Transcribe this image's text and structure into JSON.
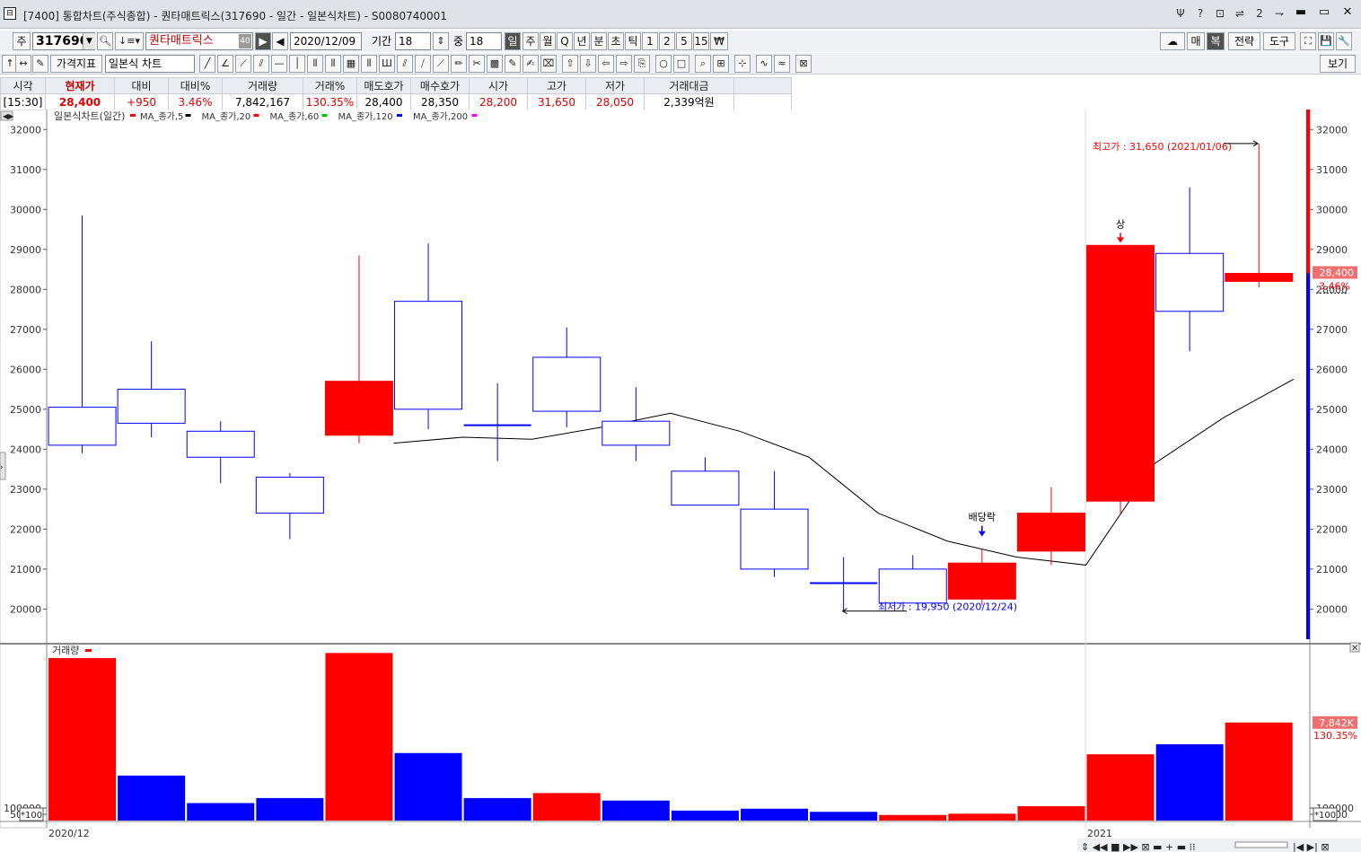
{
  "window": {
    "title": "[7400] 통합차트(주식종합) - 퀀타매트릭스(317690 - 일간 - 일본식차트) - S0080740001",
    "tbtn_icons": [
      "Ψ",
      "?",
      "⊡",
      "⇌",
      "2",
      "⇁"
    ],
    "wbtn_icons": [
      "▬",
      "▭",
      "✕"
    ]
  },
  "toolbar1": {
    "market_label": "주",
    "code": "317690",
    "stock_name": "퀀타매트릭스",
    "name_badge": "40",
    "date": "2020/12/09",
    "period_label": "기간",
    "period_value": "18",
    "mid_label": "중",
    "mid_value": "18",
    "intervals": [
      "일",
      "주",
      "월",
      "Q",
      "년",
      "분",
      "초",
      "틱",
      "1",
      "2",
      "5",
      "15",
      "₩"
    ],
    "right_buttons": [
      "매",
      "복",
      "전략",
      "도구"
    ],
    "right_icons": [
      "⛶",
      "💾",
      "🔧"
    ]
  },
  "toolbar2": {
    "indicator_btn": "가격지표",
    "chart_type": "일본식 차트",
    "view_btn": "보기"
  },
  "quote": {
    "headers": [
      "시각",
      "현재가",
      "대비",
      "대비%",
      "거래량",
      "거래%",
      "매도호가",
      "매수호가",
      "시가",
      "고가",
      "저가",
      "거래대금"
    ],
    "values": [
      "[15:30]",
      "28,400",
      "+950",
      "3.46%",
      "7,842,167",
      "130.35%",
      "28,400",
      "28,350",
      "28,200",
      "31,650",
      "28,050",
      "2,339억원"
    ]
  },
  "colors": {
    "up": "#ff0000",
    "down": "#0000ff",
    "ma20": "#000000",
    "ma5": "#ff0000",
    "ma60": "#ff0000",
    "ma120": "#00c000",
    "ma200": "#0000ff",
    "ma_extra": "#ff00ff"
  },
  "chart_data": {
    "type": "candlestick",
    "title": "일본식차트(일간)",
    "legend": [
      "MA_종가,5",
      "MA_종가,20",
      "MA_종가,60",
      "MA_종가,120",
      "MA_종가,200"
    ],
    "ylim": [
      19200,
      32500
    ],
    "yticks": [
      20000,
      21000,
      22000,
      23000,
      24000,
      25000,
      26000,
      27000,
      28000,
      29000,
      30000,
      31000,
      32000
    ],
    "candles": [
      {
        "open": 25050,
        "high": 29850,
        "low": 23900,
        "close": 24100,
        "vol": 13000
      },
      {
        "open": 25500,
        "high": 26700,
        "low": 24300,
        "close": 24650,
        "vol": 3600
      },
      {
        "open": 24450,
        "high": 24700,
        "low": 23150,
        "close": 23800,
        "vol": 1400
      },
      {
        "open": 23300,
        "high": 23400,
        "low": 21750,
        "close": 22400,
        "vol": 1800
      },
      {
        "open": 24350,
        "high": 28850,
        "low": 24150,
        "close": 25700,
        "vol": 13400
      },
      {
        "open": 27700,
        "high": 29150,
        "low": 24500,
        "close": 25000,
        "vol": 5400
      },
      {
        "open": 24600,
        "high": 25650,
        "low": 23700,
        "close": 24600,
        "vol": 1800
      },
      {
        "open": 26300,
        "high": 27050,
        "low": 24550,
        "close": 24950,
        "vol": 2200
      },
      {
        "open": 24700,
        "high": 25550,
        "low": 23700,
        "close": 24100,
        "vol": 1600
      },
      {
        "open": 23450,
        "high": 23800,
        "low": 22600,
        "close": 22600,
        "vol": 800
      },
      {
        "open": 22500,
        "high": 23450,
        "low": 20800,
        "close": 21000,
        "vol": 950
      },
      {
        "open": 20650,
        "high": 21300,
        "low": 19950,
        "close": 20650,
        "vol": 700
      },
      {
        "open": 21000,
        "high": 21350,
        "low": 20250,
        "close": 20150,
        "vol": 450
      },
      {
        "open": 20250,
        "high": 21500,
        "low": 20100,
        "close": 21150,
        "vol": 550
      },
      {
        "open": 21450,
        "high": 23050,
        "low": 21100,
        "close": 22400,
        "vol": 1150
      },
      {
        "open": 22700,
        "high": 29100,
        "low": 22400,
        "close": 29100,
        "vol": 5300
      },
      {
        "open": 28900,
        "high": 30550,
        "low": 26450,
        "close": 27450,
        "vol": 6100
      },
      {
        "open": 28200,
        "high": 31650,
        "low": 28050,
        "close": 28400,
        "vol": 7842
      }
    ],
    "ma20": [
      null,
      null,
      null,
      null,
      null,
      24150,
      24300,
      24250,
      24550,
      24900,
      24450,
      23800,
      22400,
      21700,
      21300,
      21100,
      23650,
      24800,
      25750
    ],
    "max_label": "최고가 : 31,650 (2021/01/06)",
    "min_label": "최저가 : 19,950 (2020/12/24)",
    "dividend_label": "배당락",
    "limit_up_label": "상",
    "current_price_label": "28,400",
    "current_pct_label": "3.46%",
    "volume_title": "거래량",
    "volume_yticks": [
      50000,
      100000
    ],
    "volume_max": 14000,
    "volume_current_label": "7,842K",
    "volume_pct_label": "130.35%",
    "scale_label": "*100",
    "x_labels": [
      "2020/12",
      "2021"
    ]
  }
}
